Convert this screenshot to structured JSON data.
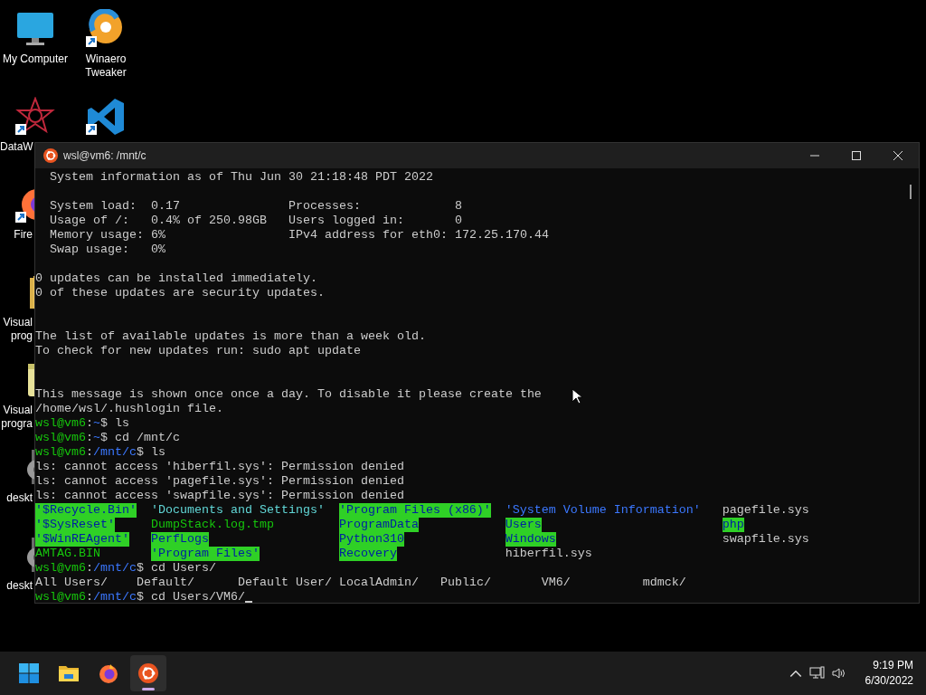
{
  "desktop_icons": [
    {
      "label": "My Computer",
      "kind": "monitor",
      "shortcut": false,
      "cut": false
    },
    {
      "label": "Winaero Tweaker",
      "kind": "swirl",
      "shortcut": true,
      "cut": false
    },
    {
      "label": "DataW",
      "kind": "star",
      "shortcut": true,
      "cut": true
    },
    {
      "kind": "code",
      "shortcut": true
    },
    {
      "label": "Fire",
      "kind": "fox",
      "shortcut": true,
      "cut": true
    },
    {
      "label": "Visual prog",
      "kind": "folder",
      "shortcut": false,
      "cut": true
    },
    {
      "label": "Visual progra",
      "kind": "archive",
      "shortcut": false,
      "cut": true
    },
    {
      "label": "deskt",
      "kind": "gear",
      "shortcut": false,
      "cut": true
    },
    {
      "label": "deskt",
      "kind": "gear",
      "shortcut": false,
      "cut": true
    }
  ],
  "window": {
    "title": "wsl@vm6: /mnt/c"
  },
  "terminal": {
    "lines": [
      {
        "kind": "indented",
        "text": "System information as of Thu Jun 30 21:18:48 PDT 2022"
      },
      {
        "kind": "blank"
      },
      {
        "kind": "indented",
        "text": "System load:  0.17               Processes:             8"
      },
      {
        "kind": "indented",
        "text": "Usage of /:   0.4% of 250.98GB   Users logged in:       0"
      },
      {
        "kind": "indented",
        "text": "Memory usage: 6%                 IPv4 address for eth0: 172.25.170.44"
      },
      {
        "kind": "indented",
        "text": "Swap usage:   0%"
      },
      {
        "kind": "blank"
      },
      {
        "kind": "text",
        "text": "0 updates can be installed immediately."
      },
      {
        "kind": "text",
        "text": "0 of these updates are security updates."
      },
      {
        "kind": "blank"
      },
      {
        "kind": "blank"
      },
      {
        "kind": "text",
        "text": "The list of available updates is more than a week old."
      },
      {
        "kind": "text",
        "text": "To check for new updates run: sudo apt update"
      },
      {
        "kind": "blank"
      },
      {
        "kind": "blank"
      },
      {
        "kind": "text",
        "text": "This message is shown once once a day. To disable it please create the"
      },
      {
        "kind": "text",
        "text": "/home/wsl/.hushlogin file."
      },
      {
        "kind": "prompt",
        "cursor": false,
        "segments": [
          {
            "text": "wsl@vm6",
            "kind": "user"
          },
          {
            "text": ":",
            "kind": "plain"
          },
          {
            "text": "~",
            "kind": "path"
          },
          {
            "text": "$ ls",
            "kind": "plain"
          }
        ]
      },
      {
        "kind": "prompt",
        "cursor": false,
        "segments": [
          {
            "text": "wsl@vm6",
            "kind": "user"
          },
          {
            "text": ":",
            "kind": "plain"
          },
          {
            "text": "~",
            "kind": "path"
          },
          {
            "text": "$ cd /mnt/c",
            "kind": "plain"
          }
        ]
      },
      {
        "kind": "prompt",
        "cursor": false,
        "segments": [
          {
            "text": "wsl@vm6",
            "kind": "user"
          },
          {
            "text": ":",
            "kind": "plain"
          },
          {
            "text": "/mnt/c",
            "kind": "path"
          },
          {
            "text": "$ ls",
            "kind": "plain"
          }
        ]
      },
      {
        "kind": "text",
        "text": "ls: cannot access 'hiberfil.sys': Permission denied"
      },
      {
        "kind": "text",
        "text": "ls: cannot access 'pagefile.sys': Permission denied"
      },
      {
        "kind": "text",
        "text": "ls: cannot access 'swapfile.sys': Permission denied"
      },
      {
        "kind": "listing",
        "rows": [
          [
            {
              "text": "'$Recycle.Bin'",
              "kind": "ow-dir"
            },
            {
              "text": "'Documents and Settings'",
              "kind": "link"
            },
            {
              "text": "'Program Files (x86)'",
              "kind": "ow-dir"
            },
            {
              "text": "'System Volume Information'",
              "kind": "dir"
            },
            {
              "text": "pagefile.sys",
              "kind": "file"
            }
          ],
          [
            {
              "text": "'$SysReset'",
              "kind": "ow-dir"
            },
            {
              "text": "DumpStack.log.tmp",
              "kind": "exec"
            },
            {
              "text": "ProgramData",
              "kind": "ow-dir"
            },
            {
              "text": "Users",
              "kind": "ow-dir"
            },
            {
              "text": "php",
              "kind": "ow-dir"
            }
          ],
          [
            {
              "text": "'$WinREAgent'",
              "kind": "ow-dir"
            },
            {
              "text": "PerfLogs",
              "kind": "ow-dir"
            },
            {
              "text": "Python310",
              "kind": "ow-dir"
            },
            {
              "text": "Windows",
              "kind": "ow-dir"
            },
            {
              "text": "swapfile.sys",
              "kind": "file"
            }
          ],
          [
            {
              "text": "AMTAG.BIN",
              "kind": "exec"
            },
            {
              "text": "'Program Files'",
              "kind": "ow-dir"
            },
            {
              "text": "Recovery",
              "kind": "ow-dir"
            },
            {
              "text": "hiberfil.sys",
              "kind": "file"
            }
          ]
        ]
      },
      {
        "kind": "prompt",
        "cursor": false,
        "segments": [
          {
            "text": "wsl@vm6",
            "kind": "user"
          },
          {
            "text": ":",
            "kind": "plain"
          },
          {
            "text": "/mnt/c",
            "kind": "path"
          },
          {
            "text": "$ cd Users/",
            "kind": "plain"
          }
        ]
      },
      {
        "kind": "text",
        "text": "All Users/    Default/      Default User/ LocalAdmin/   Public/       VM6/          mdmck/"
      },
      {
        "kind": "prompt",
        "cursor": true,
        "segments": [
          {
            "text": "wsl@vm6",
            "kind": "user"
          },
          {
            "text": ":",
            "kind": "plain"
          },
          {
            "text": "/mnt/c",
            "kind": "path"
          },
          {
            "text": "$ cd Users/VM6/",
            "kind": "plain"
          }
        ]
      }
    ]
  },
  "taskbar": {
    "apps": [
      {
        "kind": "start",
        "selected": false
      },
      {
        "kind": "files",
        "selected": false
      },
      {
        "kind": "fox",
        "selected": false
      },
      {
        "kind": "ubuntu",
        "selected": true
      }
    ],
    "time": "9:19 PM",
    "date": "6/30/2022"
  }
}
